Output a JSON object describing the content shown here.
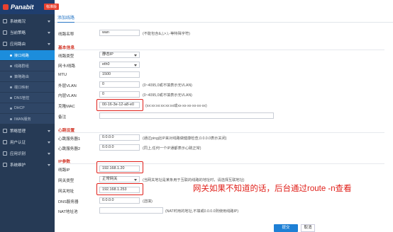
{
  "app": {
    "logo_text": "Panabit",
    "edition_tag": "标准版"
  },
  "sidebar": {
    "items": [
      {
        "label": "系统概况"
      },
      {
        "label": "当前策略"
      },
      {
        "label": "应用路由"
      },
      {
        "label": "策略管理"
      },
      {
        "label": "用户认证"
      },
      {
        "label": "应用识别"
      },
      {
        "label": "系统维护"
      }
    ],
    "subitems": [
      {
        "label": "接口线路",
        "active": true
      },
      {
        "label": "线路群组"
      },
      {
        "label": "策略路由"
      },
      {
        "label": "端口映射"
      },
      {
        "label": "DNS管控"
      },
      {
        "label": "DHCP"
      },
      {
        "label": "IWAN服务"
      }
    ]
  },
  "tab": {
    "label": "添加线路"
  },
  "form": {
    "line_name": {
      "label": "线路名称",
      "value": "wan",
      "hint": "(不能包含&,|,>,\\,-等特殊字符)"
    },
    "basic_section": "基本信息",
    "line_type": {
      "label": "线路类型",
      "value": "静态IP"
    },
    "nic": {
      "label": "网卡/线路",
      "value": "eth0"
    },
    "mtu": {
      "label": "MTU",
      "value": "1500"
    },
    "outer_vlan": {
      "label": "外层VLAN",
      "value": "0",
      "hint": "(0~4095,0或不填表示无VLAN)"
    },
    "inner_vlan": {
      "label": "内层VLAN",
      "value": "0",
      "hint": "(0~4095,0或不填表示无VLAN)"
    },
    "clone_mac": {
      "label": "克隆MAC",
      "value": "00-16-3e-12-a8-e0",
      "hint": "(xx:xx:xx:xx:xx:xx或xx-xx-xx-xx-xx-xx)"
    },
    "remark": {
      "label": "备注",
      "value": ""
    },
    "heartbeat_section": "心跳设置",
    "hb1": {
      "label": "心跳服务器1",
      "value": "0.0.0.0",
      "hint": "(通过ping此IP来对线路做健康检查,0.0.0.0表示关闭)"
    },
    "hb2": {
      "label": "心跳服务器2",
      "value": "0.0.0.0",
      "hint": "(同上,任何一个IP通都表示心跳正常)"
    },
    "ip_section": "IP参数",
    "line_ip": {
      "label": "线路IP",
      "value": "192.168.1.20"
    },
    "gw_type": {
      "label": "网关类型",
      "value": "正常网关",
      "hint": "(当网关地址是某条用于互联的线路的地址时，请选择互联地址)"
    },
    "gw_addr": {
      "label": "网关地址",
      "value": "192.168.1.253"
    },
    "dns": {
      "label": "DNS服务器",
      "value": "0.0.0.0",
      "hint": "(选填)"
    },
    "nat_addr": {
      "label": "NAT地址池",
      "value": "",
      "hint": "(NAT时用的地址,不填或0.0.0.0则使用线路IP)"
    }
  },
  "annotation": "网关如果不知道的话，后台通过route -n查看",
  "buttons": {
    "submit": "提交",
    "cancel": "取消"
  }
}
